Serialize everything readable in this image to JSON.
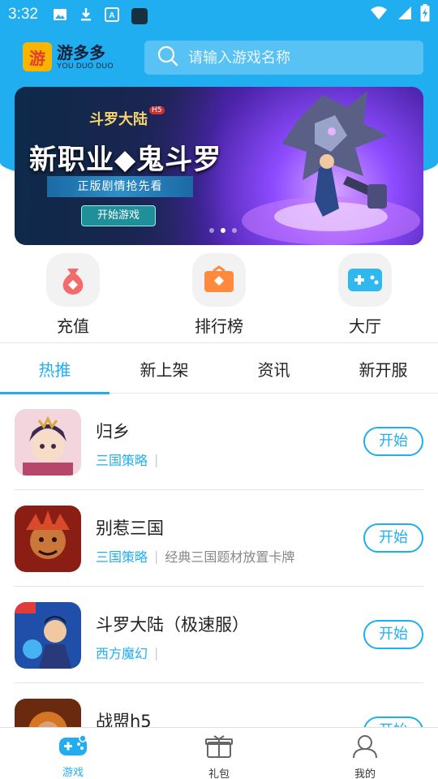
{
  "status_bar": {
    "time": "3:32",
    "icons": [
      "image-icon",
      "download-icon",
      "a-badge-icon",
      "app-square-icon",
      "wifi-icon",
      "signal-icon",
      "battery-charging-icon"
    ]
  },
  "header": {
    "logo_mark": "游",
    "logo_name": "游多多",
    "logo_en": "YOU DUO DUO",
    "search_placeholder": "请输入游戏名称"
  },
  "banner": {
    "game_title": "斗罗大陆",
    "h5": "H5",
    "headline": "新职业◆鬼斗罗",
    "ribbon": "正版剧情抢先看",
    "button": "开始游戏",
    "page_count": 3,
    "active_page": 2
  },
  "quick_entries": [
    {
      "label": "充值",
      "icon": "money-bag-icon",
      "color": "#f26a6a"
    },
    {
      "label": "排行榜",
      "icon": "ranking-card-icon",
      "color": "#ff8a3d"
    },
    {
      "label": "大厅",
      "icon": "gamepad-icon",
      "color": "#2fb7f0"
    }
  ],
  "tabs": [
    "热推",
    "新上架",
    "资讯",
    "新开服"
  ],
  "active_tab": 0,
  "games": [
    {
      "title": "归乡",
      "tag": "三国策略",
      "desc": "",
      "button": "开始"
    },
    {
      "title": "别惹三国",
      "tag": "三国策略",
      "desc": "经典三国题材放置卡牌",
      "button": "开始"
    },
    {
      "title": "斗罗大陆（极速服）",
      "tag": "西方魔幻",
      "desc": "",
      "button": "开始"
    },
    {
      "title": "战盟h5",
      "tag": "",
      "desc": "",
      "button": "开始"
    }
  ],
  "bottom_nav": [
    {
      "label": "游戏",
      "icon": "gamepad-icon",
      "active": true
    },
    {
      "label": "礼包",
      "icon": "gift-icon",
      "active": false
    },
    {
      "label": "我的",
      "icon": "user-icon",
      "active": false
    }
  ],
  "colors": {
    "accent": "#21aef0",
    "header_bg": "#21aef0"
  }
}
